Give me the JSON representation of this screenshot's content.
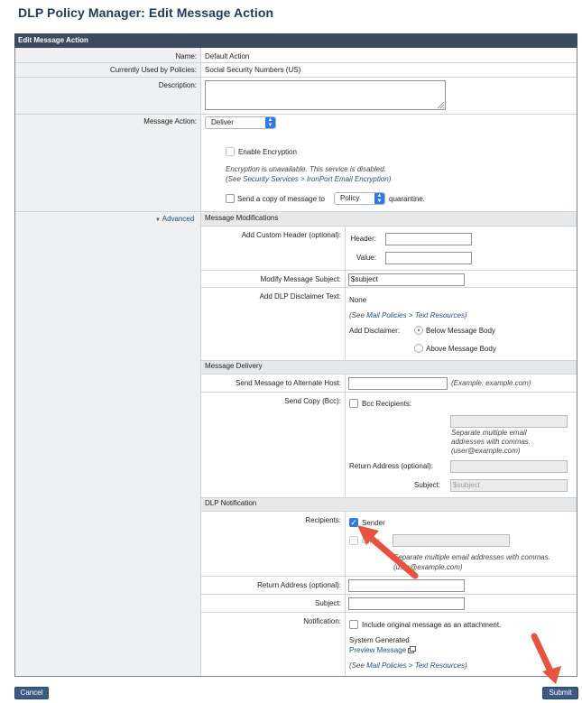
{
  "page_title": "DLP Policy Manager: Edit Message Action",
  "panel": {
    "header": "Edit Message Action",
    "name_label": "Name:",
    "name_value": "Default Action",
    "policies_label": "Currently Used by Policies:",
    "policies_value": "Social Security Numbers (US)",
    "description_label": "Description:",
    "description_value": "",
    "message_action_label": "Message Action:",
    "message_action_value": "Deliver",
    "enable_encryption_label": "Enable Encryption",
    "encryption_note": "Encryption is unavailable. This service is disabled.",
    "encryption_see_prefix": "(See ",
    "encryption_see_link": "Security Services > IronPort Email Encryption",
    "encryption_see_suffix": ")",
    "send_copy_label": "Send a copy of message to",
    "quarantine_value": "Policy",
    "quarantine_suffix": "quarantine.",
    "advanced_label": "Advanced"
  },
  "modifications": {
    "section": "Message Modifications",
    "custom_header_label": "Add Custom Header (optional):",
    "header_label": "Header:",
    "header_value": "",
    "value_label": "Value:",
    "value_value": "",
    "modify_subject_label": "Modify Message Subject:",
    "modify_subject_value": "$subject",
    "disclaimer_label": "Add DLP Disclaimer Text:",
    "disclaimer_value": "None",
    "disclaimer_see_prefix": "(See ",
    "disclaimer_see_link": "Mail Policies > Text Resources",
    "disclaimer_see_suffix": ")",
    "add_disclaimer_label": "Add Disclaimer:",
    "below_label": "Below Message Body",
    "above_label": "Above Message Body"
  },
  "delivery": {
    "section": "Message Delivery",
    "alt_host_label": "Send Message to Alternate Host:",
    "alt_host_value": "",
    "alt_host_example": "(Example: example.com)",
    "send_copy_label": "Send Copy (Bcc):",
    "bcc_label": "Bcc Recipients:",
    "bcc_value": "",
    "bcc_help_1": "Separate multiple email",
    "bcc_help_2": "addresses with commas.",
    "bcc_help_3": "(user@example.com)",
    "return_label": "Return Address (optional):",
    "return_value": "",
    "subject_label": "Subject:",
    "subject_value": "$subject"
  },
  "notification": {
    "section": "DLP Notification",
    "recipients_label": "Recipients:",
    "sender_label": "Sender",
    "other_label": "Other:",
    "other_value": "",
    "other_help_1": "Separate multiple email addresses with commas.",
    "other_help_2": "(user@example.com)",
    "return_label": "Return Address (optional):",
    "return_value": "",
    "subject_label": "Subject:",
    "subject_value": "",
    "notification_label": "Notification:",
    "include_label": "Include original message as an attachment.",
    "system_generated": "System Generated",
    "preview_link": "Preview Message",
    "see_prefix": "(See ",
    "see_link": "Mail Policies > Text Resources",
    "see_suffix": ")"
  },
  "buttons": {
    "cancel": "Cancel",
    "submit": "Submit"
  },
  "colors": {
    "header_bg": "#3b4b5e",
    "accent": "#2f7be5",
    "annotation_arrow": "#e8533f"
  }
}
